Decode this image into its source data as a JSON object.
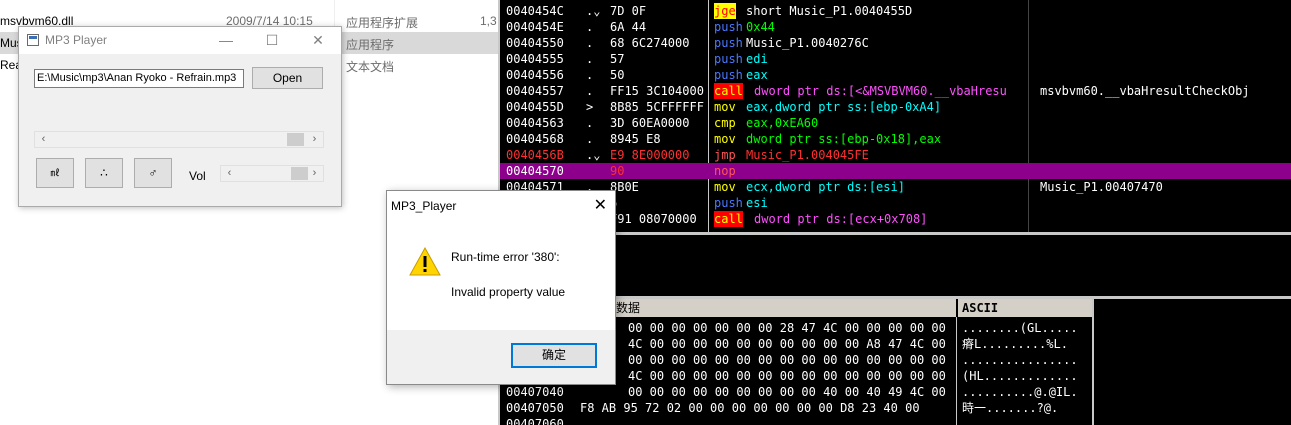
{
  "explorer": {
    "rows": [
      {
        "name": "msvbvm60.dll",
        "date": "2009/7/14 10:15",
        "type": "应用程序扩展",
        "size": "1,3"
      },
      {
        "name": "Music",
        "date": "",
        "type": "应用程序",
        "size": ""
      },
      {
        "name": "Readl",
        "date": "",
        "type": "文本文档",
        "size": ""
      }
    ]
  },
  "disasm": [
    {
      "addr": "0040454C",
      "mark": ".⌄",
      "hex": "7D 0F",
      "mn": "jge",
      "op": "short Music_P1.0040455D",
      "com": ""
    },
    {
      "addr": "0040454E",
      "mark": ".",
      "hex": "6A 44",
      "mn": "push",
      "op": "0x44",
      "com": ""
    },
    {
      "addr": "00404550",
      "mark": ".",
      "hex": "68 6C274000",
      "mn": "push",
      "op": "Music_P1.0040276C",
      "com": ""
    },
    {
      "addr": "00404555",
      "mark": ".",
      "hex": "57",
      "mn": "push",
      "op": "edi",
      "com": ""
    },
    {
      "addr": "00404556",
      "mark": ".",
      "hex": "50",
      "mn": "push",
      "op": "eax",
      "com": ""
    },
    {
      "addr": "00404557",
      "mark": ".",
      "hex": "FF15 3C104000",
      "mn": "call",
      "op": "dword ptr ds:[<&MSVBVM60.__vbaHresu",
      "com": "msvbvm60.__vbaHresultCheckObj"
    },
    {
      "addr": "0040455D",
      "mark": ">",
      "hex": "8B85 5CFFFFFF",
      "mn": "mov",
      "op": "eax,dword ptr ss:[ebp-0xA4]",
      "com": ""
    },
    {
      "addr": "00404563",
      "mark": ".",
      "hex": "3D 60EA0000",
      "mn": "cmp",
      "op": "eax,0xEA60",
      "com": ""
    },
    {
      "addr": "00404568",
      "mark": ".",
      "hex": "8945 E8",
      "mn": "mov",
      "op": "dword ptr ss:[ebp-0x18],eax",
      "com": ""
    },
    {
      "addr": "0040456B",
      "mark": ".⌄",
      "hex": "E9 8E000000",
      "mn": "jmp",
      "op": "Music_P1.004045FE",
      "com": ""
    },
    {
      "addr": "00404570",
      "mark": "",
      "hex": "90",
      "mn": "nop",
      "op": "",
      "com": ""
    },
    {
      "addr": "00404571",
      "mark": ".",
      "hex": "8B0E",
      "mn": "mov",
      "op": "ecx,dword ptr ds:[esi]",
      "com": "Music_P1.00407470"
    },
    {
      "addr": "",
      "mark": "",
      "hex": "6",
      "mn": "push",
      "op": "esi",
      "com": ""
    },
    {
      "addr": "",
      "mark": "",
      "hex": "F91 08070000",
      "mn": "call",
      "op": "dword ptr ds:[ecx+0x708]",
      "com": ""
    }
  ],
  "dump": {
    "header_data": "数据",
    "header_ascii": "ASCII",
    "rows": [
      {
        "addr": "",
        "hex": "00 00 00 00 00 00 00 28 47 4C 00 00 00 00 00",
        "ascii": "........(GL....."
      },
      {
        "addr": "",
        "hex": "4C 00 00 00 00 00 00 00 00 00 00 A8 47 4C 00",
        "ascii": "瘠L.........%L."
      },
      {
        "addr": "",
        "hex": "00 00 00 00 00 00 00 00 00 00 00 00 00 00 00",
        "ascii": "................"
      },
      {
        "addr": "",
        "hex": "4C 00 00 00 00 00 00 00 00 00 00 00 00 00 00",
        "ascii": "(HL............."
      },
      {
        "addr": "00407040",
        "hex": "00 00 00 00 00 00 00 00 00 40 00 40 49 4C 00",
        "ascii": "..........@.@IL."
      },
      {
        "addr": "00407050",
        "hex": "F8 AB 95 72 02 00 00 00 00 00 00 00 D8 23 40 00",
        "ascii": "  時一.......?@."
      },
      {
        "addr": "00407060",
        "hex": "",
        "ascii": ""
      }
    ]
  },
  "mp3": {
    "title": "MP3 Player",
    "path": "E:\\Music\\mp3\\Anan Ryoko - Refrain.mp3",
    "open_label": "Open",
    "btn1": "㎖",
    "btn2": "∴",
    "btn3": "♂",
    "vol_label": "Vol",
    "minimize": "—",
    "maximize": "☐",
    "close": "✕",
    "arrow_left": "‹",
    "arrow_right": "›"
  },
  "dialog": {
    "title": "MP3_Player",
    "message": "Run-time error '380':",
    "detail": "Invalid property value",
    "ok_label": "确定",
    "close": "✕"
  }
}
